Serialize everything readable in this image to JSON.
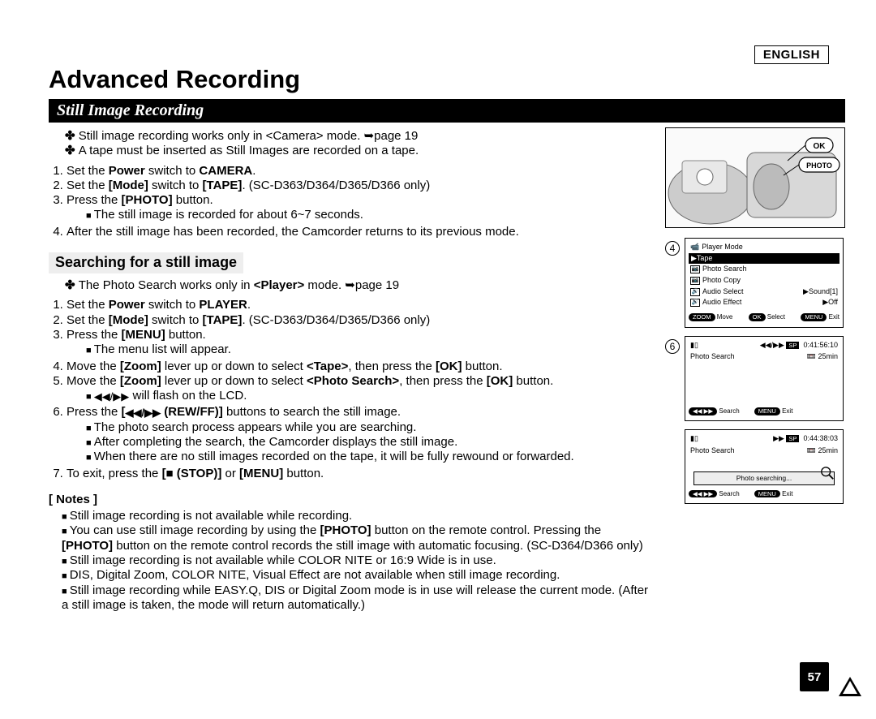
{
  "language_badge": "ENGLISH",
  "page_title": "Advanced Recording",
  "page_number": "57",
  "section": {
    "title": "Still Image Recording",
    "intro": [
      "Still image recording works only in <Camera> mode. ➥page 19",
      "A tape must be inserted as Still Images are recorded on a tape."
    ],
    "steps": [
      "Set the Power switch to CAMERA.",
      "Set the [Mode] switch to [TAPE]. (SC-D363/D364/D365/D366 only)",
      "Press the [PHOTO] button."
    ],
    "step3_sub": "The still image is recorded for about 6~7 seconds.",
    "step4": "After the still image has been recorded, the Camcorder returns to its previous mode."
  },
  "searching": {
    "title": "Searching for a still image",
    "intro": "The Photo Search works only in <Player> mode. ➥page 19",
    "steps": [
      "Set the Power switch to PLAYER.",
      "Set the [Mode] switch to [TAPE]. (SC-D363/D364/D365/D366 only)",
      "Press the [MENU] button.",
      "Move the [Zoom] lever up or down to select <Tape>, then press the [OK] button.",
      "Move the [Zoom] lever up or down to select <Photo Search>, then press the [OK] button.",
      "Press the [◀◀/▶▶ (REW/FF)] buttons to search the still image.",
      "To exit, press the [■ (STOP)] or [MENU] button."
    ],
    "step3_sub": "The menu list will appear.",
    "step5_sub": "◀◀/▶▶ will flash on the LCD.",
    "step6_subs": [
      "The photo search process appears while you are searching.",
      "After completing the search, the Camcorder displays the still image.",
      "When there are no still images recorded on the tape, it will be fully rewound or forwarded."
    ]
  },
  "notes": {
    "title": "[ Notes ]",
    "items": [
      "Still image recording is not available while recording.",
      "You can use still image recording by using the [PHOTO] button on the remote control. Pressing the [PHOTO] button on the remote control records the still image with automatic focusing. (SC-D364/D366 only)",
      "Still image recording is not available while COLOR NITE or 16:9 Wide is in use.",
      "DIS, Digital Zoom, COLOR NITE, Visual Effect are not available when still image recording.",
      "Still image recording while EASY.Q, DIS or Digital Zoom mode is in use will release the current mode. (After a still image is taken, the mode will return automatically.)"
    ]
  },
  "illustrations": {
    "camera": {
      "ok_label": "OK",
      "photo_label": "PHOTO"
    },
    "step4_marker": "4",
    "menu_lcd": {
      "header": "Player Mode",
      "selected": "▶Tape",
      "items": [
        {
          "icon": "📷",
          "label": "Photo Search",
          "value": ""
        },
        {
          "icon": "📷",
          "label": "Photo Copy",
          "value": ""
        },
        {
          "icon": "🔊",
          "label": "Audio Select",
          "value": "▶Sound[1]"
        },
        {
          "icon": "🔊",
          "label": "Audio Effect",
          "value": "▶Off"
        }
      ],
      "footer": {
        "zoom": "ZOOM",
        "zoom_label": "Move",
        "ok": "OK",
        "ok_label": "Select",
        "menu": "MENU",
        "menu_label": "Exit"
      }
    },
    "step6_marker": "6",
    "search_lcd": {
      "sp": "SP",
      "time": "0:41:56:10",
      "title": "Photo Search",
      "remain": "25min",
      "footer_search": "Search",
      "footer_menu": "MENU",
      "footer_exit": "Exit"
    },
    "searching_lcd": {
      "sp": "SP",
      "time": "0:44:38:03",
      "title": "Photo Search",
      "remain": "25min",
      "message": "Photo searching...",
      "footer_search": "Search",
      "footer_menu": "MENU",
      "footer_exit": "Exit"
    }
  }
}
